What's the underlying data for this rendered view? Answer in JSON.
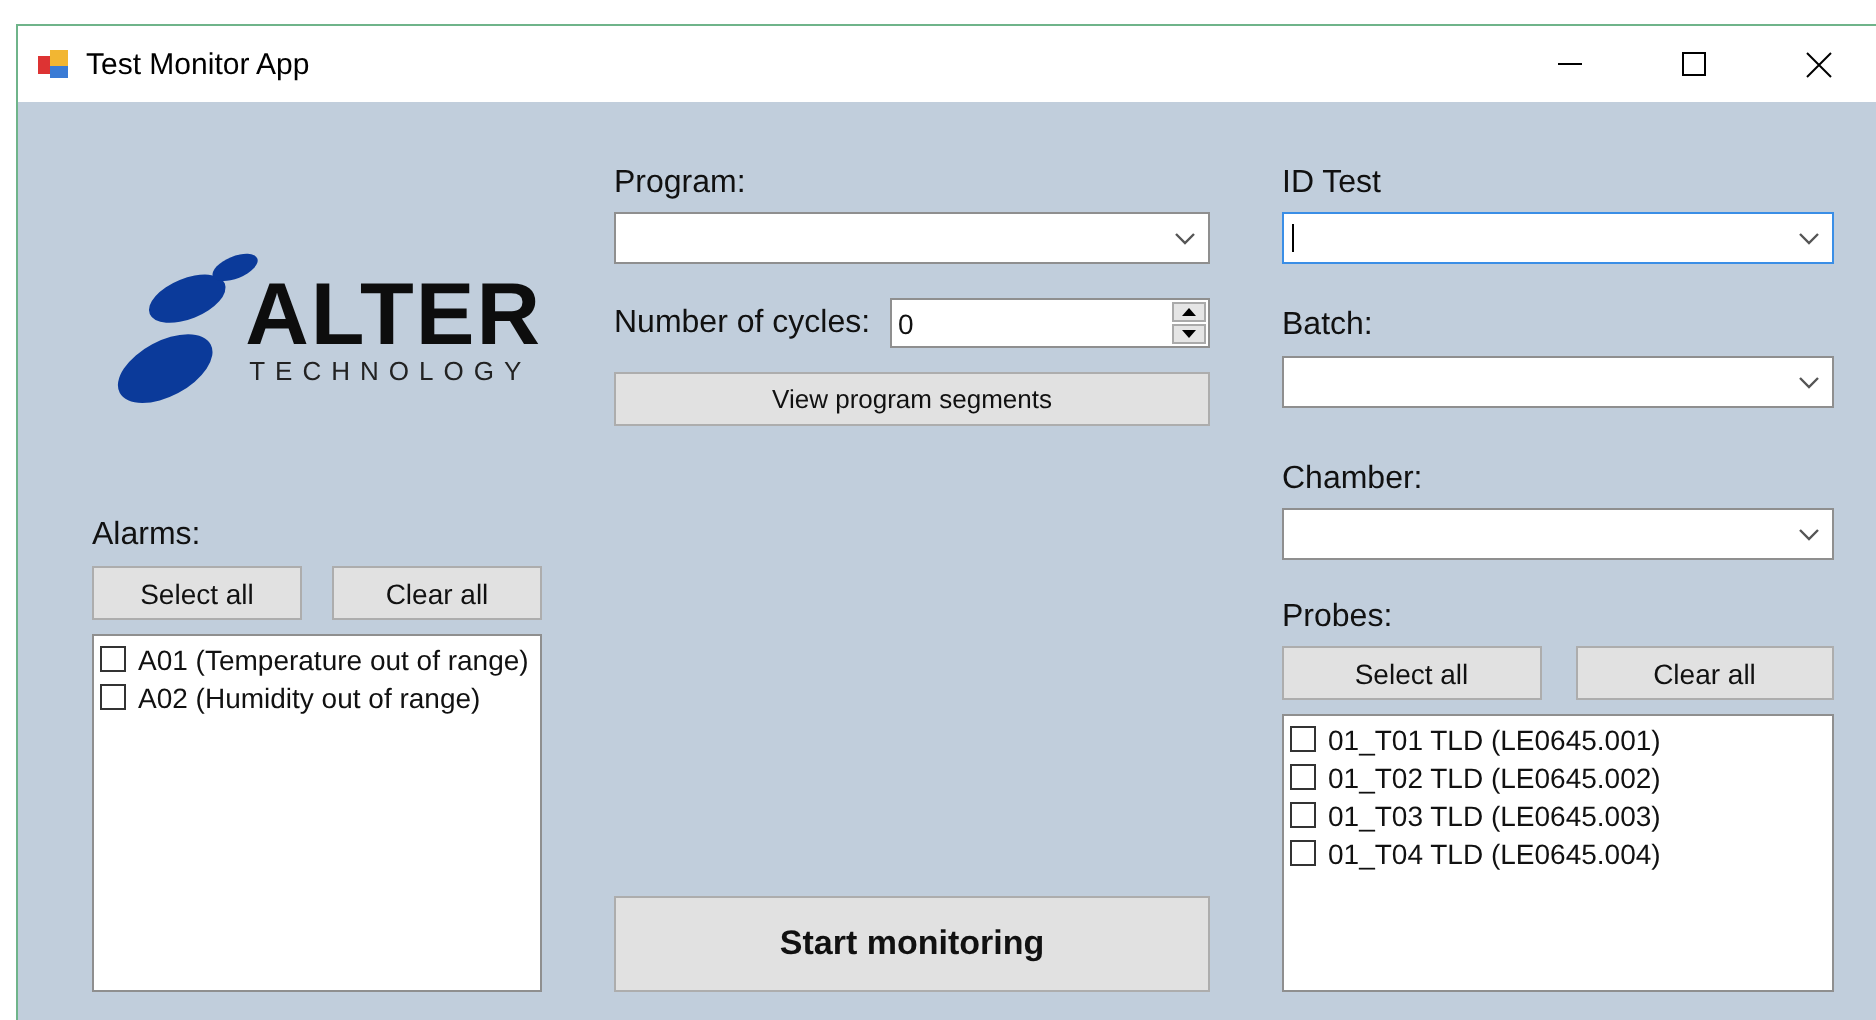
{
  "window": {
    "title": "Test Monitor App"
  },
  "logo": {
    "name": "ALTER",
    "tagline": "TECHNOLOGY"
  },
  "alarms": {
    "label": "Alarms:",
    "buttons": [
      "Select all",
      "Clear all"
    ],
    "items": [
      {
        "label": "A01 (Temperature out of range)",
        "checked": false
      },
      {
        "label": "A02 (Humidity out of range)",
        "checked": false
      }
    ]
  },
  "program": {
    "label": "Program:",
    "focused": false
  },
  "cycles": {
    "label": "Number of cycles:",
    "value": "0"
  },
  "view_button": "View program segments",
  "start_button": "Start monitoring",
  "id_test": {
    "label": "ID Test",
    "focused": true
  },
  "batch": {
    "label": "Batch:",
    "focused": false
  },
  "chamber": {
    "label": "Chamber:",
    "focused": false
  },
  "probes": {
    "label": "Probes:",
    "buttons": [
      "Select all",
      "Clear all"
    ],
    "items": [
      {
        "label": "01_T01 TLD (LE0645.001)",
        "checked": false
      },
      {
        "label": "01_T02 TLD (LE0645.002)",
        "checked": false
      },
      {
        "label": "01_T03 TLD (LE0645.003)",
        "checked": false
      },
      {
        "label": "01_T04 TLD (LE0645.004)",
        "checked": false
      }
    ]
  }
}
